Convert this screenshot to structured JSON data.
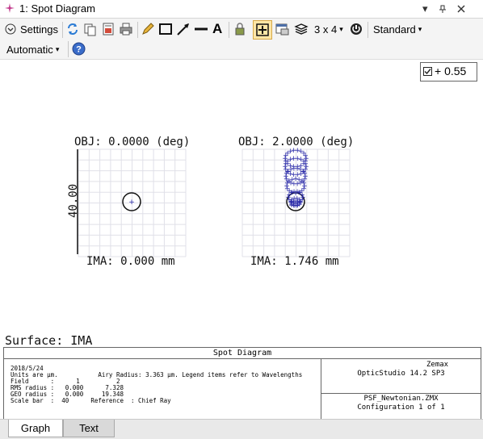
{
  "window": {
    "title": "1: Spot Diagram",
    "pin_icon": "pin-icon",
    "dropdown_icon": "chevron-down-icon",
    "close_icon": "close-icon"
  },
  "toolbar": {
    "settings_label": "Settings",
    "layout_label": "3 x 4",
    "standard_label": "Standard",
    "automatic_label": "Automatic"
  },
  "plot": {
    "legend_label": "+ 0.55",
    "field1_obj": "OBJ: 0.0000 (deg)",
    "field1_ima": "IMA: 0.000 mm",
    "field2_obj": "OBJ: 2.0000 (deg)",
    "field2_ima": "IMA: 1.746 mm",
    "scale_label": "40.00",
    "surface_label": "Surface: IMA",
    "wavelength_color": "#2a2aa8",
    "grid_color": "#e0e0e8"
  },
  "info": {
    "title": "Spot Diagram",
    "date": "2018/5/24",
    "units_line": "Units are µm.           Airy Radius: 3.363 µm. Legend items refer to Wavelengths",
    "field_line": "Field      :      1          2",
    "rms_line": "RMS radius :   0.000      7.328",
    "geo_line": "GEO radius :   0.000     19.348",
    "scale_line": "Scale bar  :  40      Reference  : Chief Ray",
    "vendor": "Zemax",
    "product": "OpticStudio 14.2 SP3",
    "file": "PSF_Newtonian.ZMX",
    "config": "Configuration 1 of 1"
  },
  "tabs": [
    {
      "label": "Graph"
    },
    {
      "label": "Text"
    }
  ]
}
